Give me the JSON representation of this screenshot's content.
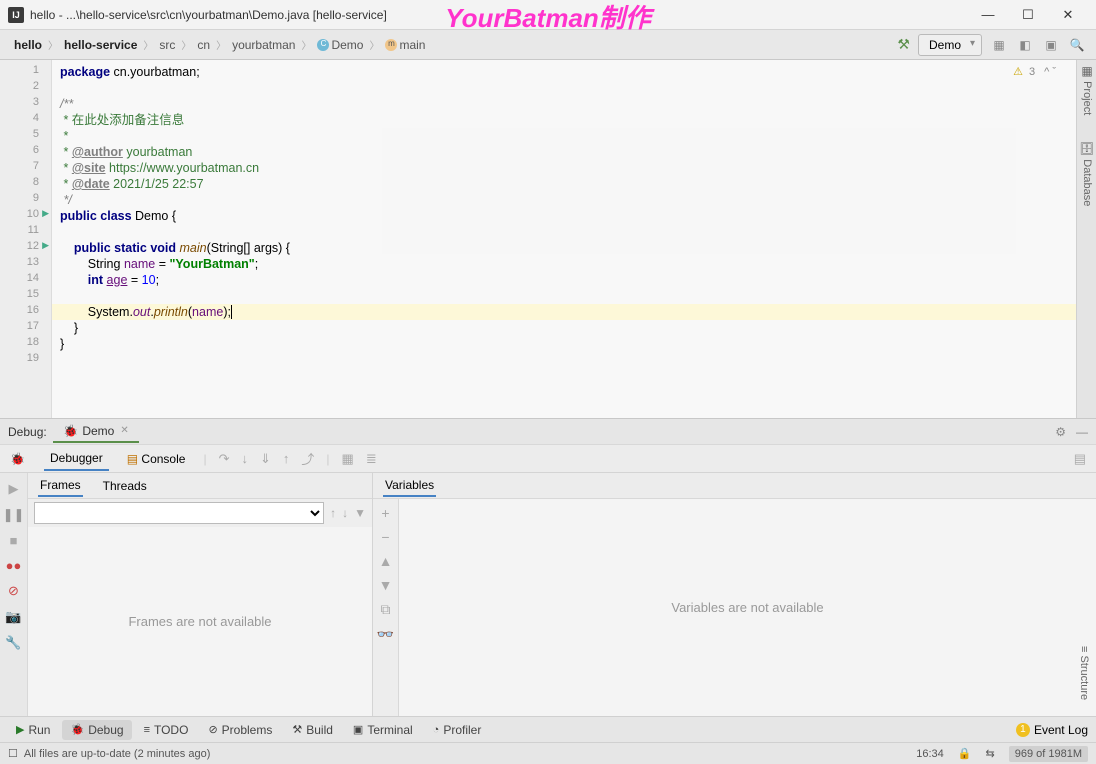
{
  "title_bar": {
    "title": "hello - ...\\hello-service\\src\\cn\\yourbatman\\Demo.java [hello-service]"
  },
  "watermark": "YourBatman制作",
  "breadcrumb": {
    "items": [
      "hello",
      "hello-service",
      "src",
      "cn",
      "yourbatman",
      "Demo",
      "main"
    ]
  },
  "run_config": "Demo",
  "editor_warnings": {
    "warn_count": "3"
  },
  "gutter_lines": [
    "1",
    "2",
    "3",
    "4",
    "5",
    "6",
    "7",
    "8",
    "9",
    "10",
    "11",
    "12",
    "13",
    "14",
    "15",
    "16",
    "17",
    "18",
    "19"
  ],
  "code": {
    "l1_kw": "package",
    "l1_rest": " cn.yourbatman;",
    "l3": "/**",
    "l4": " * 在此处添加备注信息",
    "l5": " *",
    "l6a": " * ",
    "l6b": "@author",
    "l6c": " yourbatman",
    "l7a": " * ",
    "l7b": "@site",
    "l7c": " https://www.yourbatman.cn",
    "l8a": " * ",
    "l8b": "@date",
    "l8c": " 2021/1/25 22:57",
    "l9": " */",
    "l10a": "public class ",
    "l10b": "Demo",
    "l10c": " {",
    "l12a": "public static ",
    "l12b": "void",
    "l12c": " main",
    "l12d": "(",
    "l12e": "String",
    "l12f": "[] args) {",
    "l13a": "String ",
    "l13b": "name",
    "l13c": " = ",
    "l13d": "\"YourBatman\"",
    "l13e": ";",
    "l14a": "int ",
    "l14b": "age",
    "l14c": " = ",
    "l14d": "10",
    "l14e": ";",
    "l16a": "System.",
    "l16b": "out",
    "l16c": ".",
    "l16d": "println",
    "l16e": "(",
    "l16f": "name",
    "l16g": ");",
    "l17": "}",
    "l18": "}"
  },
  "right_side_tabs": {
    "project": "Project",
    "database": "Database",
    "structure": "Structure"
  },
  "debug_panel": {
    "label": "Debug:",
    "tab_name": "Demo",
    "sub_debugger": "Debugger",
    "sub_console": "Console",
    "frames_tab": "Frames",
    "threads_tab": "Threads",
    "vars_tab": "Variables",
    "frames_empty": "Frames are not available",
    "vars_empty": "Variables are not available"
  },
  "bottom_tabs": {
    "run": "Run",
    "debug": "Debug",
    "todo": "TODO",
    "problems": "Problems",
    "build": "Build",
    "terminal": "Terminal",
    "profiler": "Profiler",
    "event_log": "Event Log"
  },
  "status_bar": {
    "msg": "All files are up-to-date (2 minutes ago)",
    "time": "16:34",
    "memory": "969 of 1981M"
  }
}
